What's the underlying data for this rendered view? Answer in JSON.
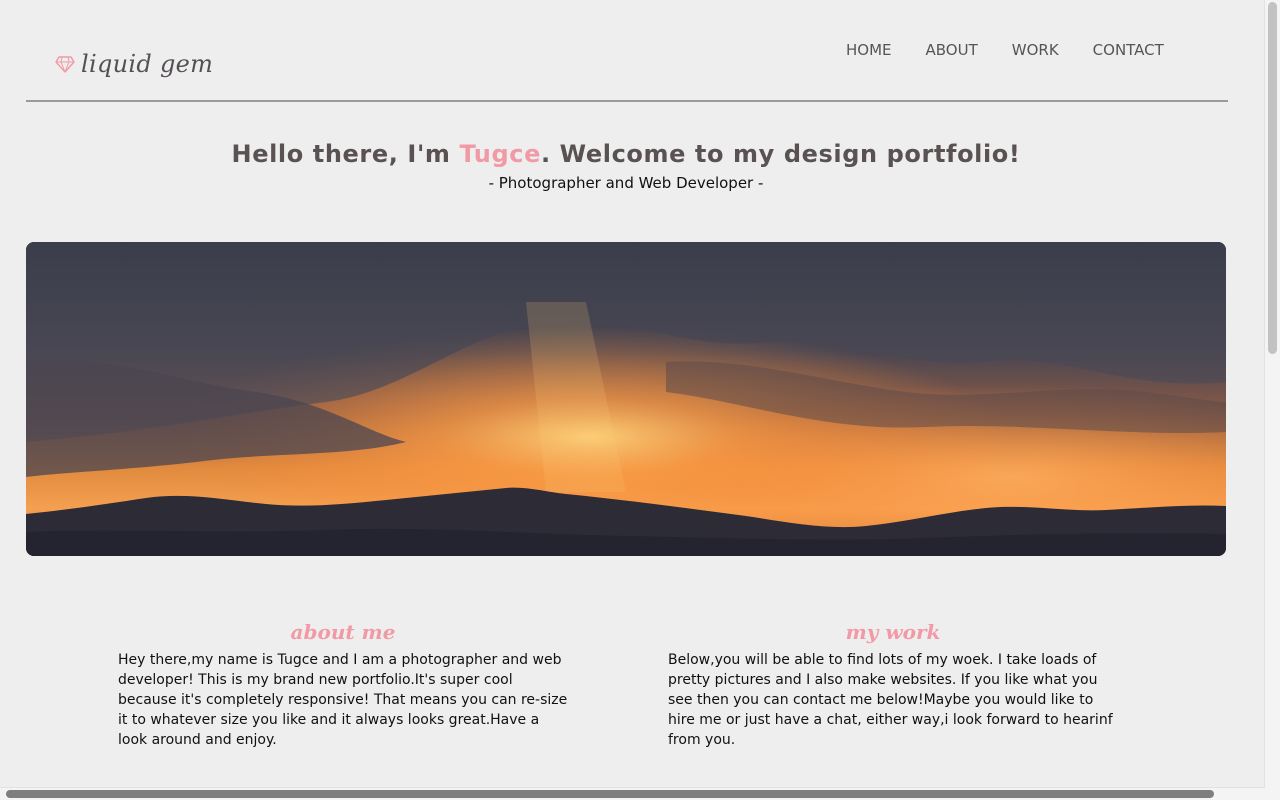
{
  "header": {
    "logo_icon": "diamond-icon",
    "logo_text": "liquid gem",
    "nav": [
      "HOME",
      "ABOUT",
      "WORK",
      "CONTACT"
    ]
  },
  "intro": {
    "greeting_before": "Hello there, I'm ",
    "name": "Tugce",
    "greeting_after": ". Welcome to my design portfolio!",
    "subtitle": "- Photographer and Web Developer -"
  },
  "banner": {
    "description": "sunset-over-mountains-photo"
  },
  "about": {
    "heading": "about me",
    "text": "Hey there,my name is Tugce and I am a photographer and web developer! This is my brand new portfolio.It's super cool because it's completely responsive! That means you can re-size it to whatever size you like and it always looks great.Have a look around and enjoy."
  },
  "work": {
    "heading": "my work",
    "text": "Below,you will be able to find lots of my woek. I take loads of pretty pictures and I also make websites. If you like what you see then you can contact me below!Maybe you would like to hire me or just have a chat, either way,i look forward to hearinf from you."
  },
  "colors": {
    "accent": "#f19aa6",
    "text_dark": "#5a5252",
    "background": "#eeeeee"
  }
}
